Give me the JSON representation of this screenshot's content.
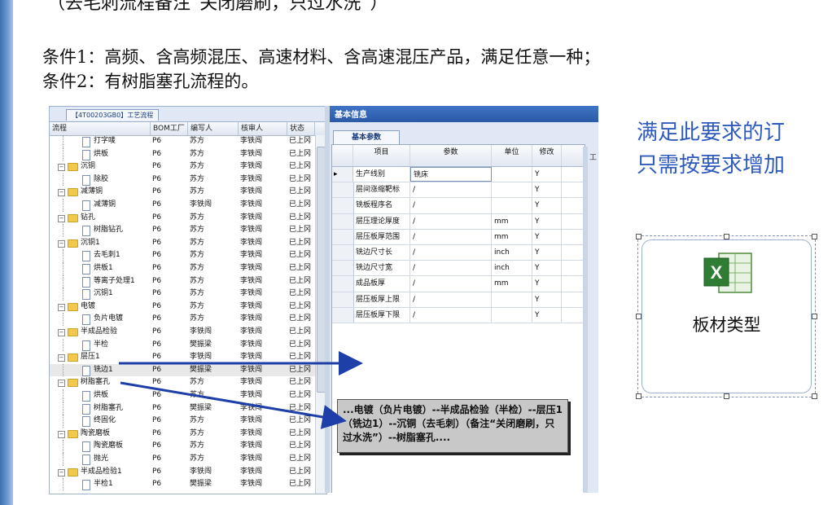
{
  "slide": {
    "top_note": "（去毛刺流程备注“关闭磨刷，只过水洗”）",
    "condition1": "条件1：高频、含高频混压、高速材料、含高速混压产品，满足任意一种；",
    "condition2": "条件2：有树脂塞孔流程的。",
    "side_line1": "满足此要求的订",
    "side_line2": "只需按要求增加",
    "callout": "...电镀（负片电镀）--半成品检验（半检）--层压1（铣边1）--沉铜（去毛刺）（备注“关闭磨刷，只过水洗”）--树脂塞孔...."
  },
  "tree_panel": {
    "tab": "【4T00203GB0】工艺流程",
    "columns": [
      "流程",
      "BOM工厂",
      "编写人",
      "核审人",
      "状态"
    ],
    "rows": [
      {
        "name": "打字唛",
        "level": 2,
        "factory": "P6",
        "writer": "苏方",
        "reviewer": "李铁闯",
        "status": "已上冈"
      },
      {
        "name": "烘板",
        "level": 2,
        "factory": "P6",
        "writer": "苏方",
        "reviewer": "李铁闯",
        "status": "已上冈"
      },
      {
        "name": "沉铜",
        "level": 1,
        "factory": "P6",
        "writer": "苏方",
        "reviewer": "李铁闯",
        "status": "已上冈"
      },
      {
        "name": "除胶",
        "level": 2,
        "factory": "P6",
        "writer": "苏方",
        "reviewer": "李铁闯",
        "status": "已上冈"
      },
      {
        "name": "减薄铜",
        "level": 1,
        "factory": "P6",
        "writer": "苏方",
        "reviewer": "李铁闯",
        "status": "已上冈"
      },
      {
        "name": "减薄铜",
        "level": 2,
        "factory": "P6",
        "writer": "李铁闯",
        "reviewer": "李铁闯",
        "status": "已上冈"
      },
      {
        "name": "钻孔",
        "level": 1,
        "factory": "P6",
        "writer": "苏方",
        "reviewer": "李铁闯",
        "status": "已上冈"
      },
      {
        "name": "树脂钻孔",
        "level": 2,
        "factory": "P6",
        "writer": "苏方",
        "reviewer": "李铁闯",
        "status": "已上冈"
      },
      {
        "name": "沉铜1",
        "level": 1,
        "factory": "P6",
        "writer": "苏方",
        "reviewer": "李铁闯",
        "status": "已上冈"
      },
      {
        "name": "去毛刺1",
        "level": 2,
        "factory": "P6",
        "writer": "苏方",
        "reviewer": "李铁闯",
        "status": "已上冈"
      },
      {
        "name": "烘板1",
        "level": 2,
        "factory": "P6",
        "writer": "苏方",
        "reviewer": "李铁闯",
        "status": "已上冈"
      },
      {
        "name": "等离子处理1",
        "level": 2,
        "factory": "P6",
        "writer": "苏方",
        "reviewer": "李铁闯",
        "status": "已上冈"
      },
      {
        "name": "沉铜1",
        "level": 2,
        "factory": "P6",
        "writer": "苏方",
        "reviewer": "李铁闯",
        "status": "已上冈"
      },
      {
        "name": "电镀",
        "level": 1,
        "factory": "P6",
        "writer": "苏方",
        "reviewer": "李铁闯",
        "status": "已上冈"
      },
      {
        "name": "负片电镀",
        "level": 2,
        "factory": "P6",
        "writer": "苏方",
        "reviewer": "李铁闯",
        "status": "已上冈"
      },
      {
        "name": "半成品检验",
        "level": 1,
        "factory": "P6",
        "writer": "李铁闯",
        "reviewer": "李铁闯",
        "status": "已上冈"
      },
      {
        "name": "半检",
        "level": 2,
        "factory": "P6",
        "writer": "樊振梁",
        "reviewer": "李铁闯",
        "status": "已上冈"
      },
      {
        "name": "层压1",
        "level": 1,
        "factory": "P6",
        "writer": "李铁闯",
        "reviewer": "李铁闯",
        "status": "已上冈"
      },
      {
        "name": "铣边1",
        "level": 2,
        "factory": "P6",
        "writer": "樊振梁",
        "reviewer": "李铁闯",
        "status": "已上冈",
        "selected": true
      },
      {
        "name": "树脂塞孔",
        "level": 1,
        "factory": "P6",
        "writer": "苏方",
        "reviewer": "李铁闯",
        "status": "已上冈"
      },
      {
        "name": "烘板",
        "level": 2,
        "factory": "P6",
        "writer": "苏方",
        "reviewer": "李铁闯",
        "status": "已上冈"
      },
      {
        "name": "树脂塞孔",
        "level": 2,
        "factory": "P6",
        "writer": "樊振梁",
        "reviewer": "李铁闯",
        "status": "已上冈"
      },
      {
        "name": "终固化",
        "level": 2,
        "factory": "P6",
        "writer": "苏方",
        "reviewer": "李铁闯",
        "status": "已上冈"
      },
      {
        "name": "陶瓷磨板",
        "level": 1,
        "factory": "P6",
        "writer": "苏方",
        "reviewer": "李铁闯",
        "status": "已上冈"
      },
      {
        "name": "陶瓷磨板",
        "level": 2,
        "factory": "P6",
        "writer": "苏方",
        "reviewer": "李铁闯",
        "status": "已上冈"
      },
      {
        "name": "抛光",
        "level": 2,
        "factory": "P6",
        "writer": "苏方",
        "reviewer": "李铁闯",
        "status": "已上冈"
      },
      {
        "name": "半成品检验1",
        "level": 1,
        "factory": "P6",
        "writer": "李铁闯",
        "reviewer": "李铁闯",
        "status": "已上冈"
      },
      {
        "name": "半检1",
        "level": 2,
        "factory": "P6",
        "writer": "樊振梁",
        "reviewer": "李铁闯",
        "status": "已上冈"
      }
    ]
  },
  "info_panel": {
    "header_tab": "基本信息",
    "sub_tab": "基本参数",
    "columns": [
      "项目",
      "参数",
      "单位",
      "修改"
    ],
    "rows": [
      {
        "item": "生产线别",
        "param": "铣床",
        "unit": "",
        "edit": "Y",
        "current": true
      },
      {
        "item": "层间涨缩靶标",
        "param": "/",
        "unit": "",
        "edit": "Y"
      },
      {
        "item": "铣板程序名",
        "param": "/",
        "unit": "",
        "edit": "Y"
      },
      {
        "item": "层压理论厚度",
        "param": "/",
        "unit": "mm",
        "edit": "Y",
        "highlight": true
      },
      {
        "item": "层压板厚范围",
        "param": "/",
        "unit": "mm",
        "edit": "Y"
      },
      {
        "item": "铣边尺寸长",
        "param": "/",
        "unit": "inch",
        "edit": "Y"
      },
      {
        "item": "铣边尺寸宽",
        "param": "/",
        "unit": "inch",
        "edit": "Y"
      },
      {
        "item": "成品板厚",
        "param": "/",
        "unit": "mm",
        "edit": "Y"
      },
      {
        "item": "层压板厚上限",
        "param": "/",
        "unit": "",
        "edit": "Y"
      },
      {
        "item": "层压板厚下限",
        "param": "/",
        "unit": "",
        "edit": "Y"
      }
    ],
    "right_edge_label": "工"
  },
  "embedded_object": {
    "label": "板材类型",
    "icon": "excel-icon"
  },
  "colors": {
    "arrow": "#1f3fa8",
    "side_text": "#2f5bbf",
    "highlight_item": "#c2187a"
  }
}
